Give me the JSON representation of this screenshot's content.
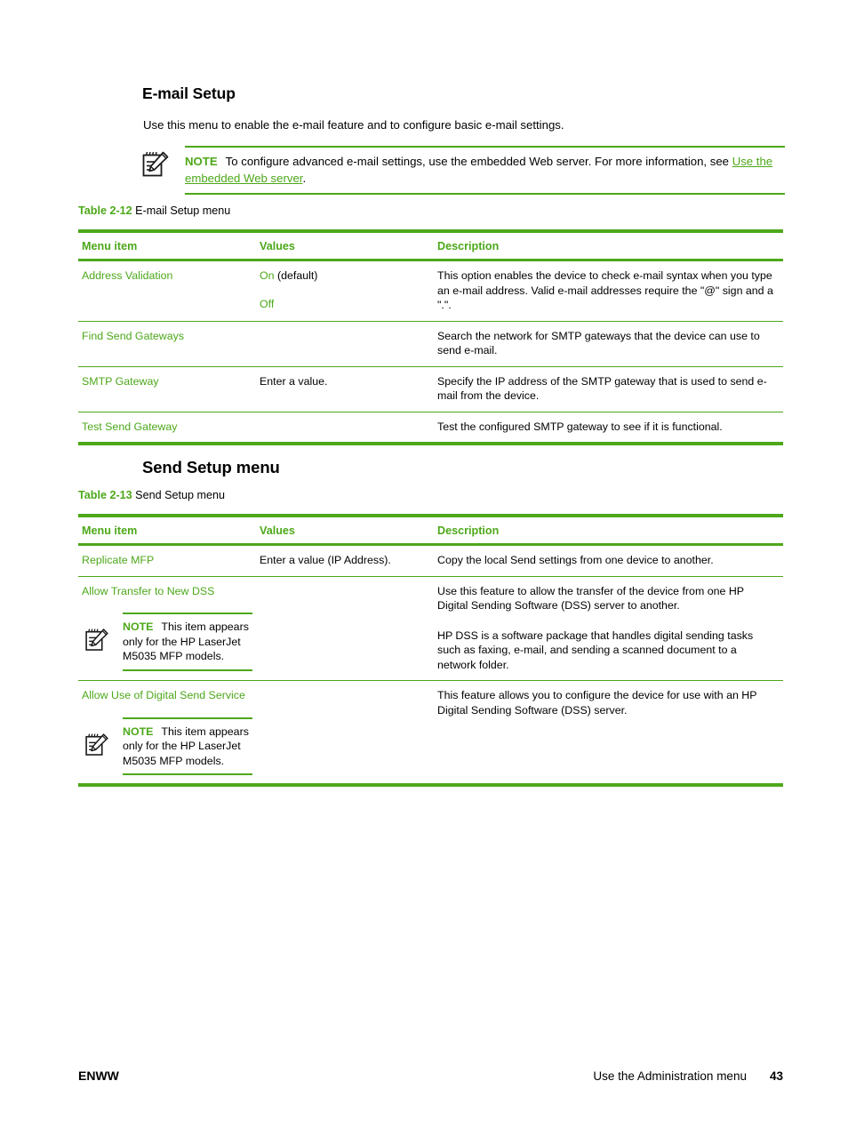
{
  "page": {
    "heading1": "E-mail Setup",
    "intro": "Use this menu to enable the e-mail feature and to configure basic e-mail settings.",
    "heading2": "Send Setup menu",
    "accent_color": "#4da81a"
  },
  "note_top": {
    "icon": "note-pad-pencil-icon",
    "label": "NOTE",
    "text_before_link": "To configure advanced e-mail settings, use the embedded Web server. For more information, see ",
    "link_text": "Use the embedded Web server",
    "text_after_link": "."
  },
  "table_1": {
    "caption_number": "Table 2-12",
    "caption_title": "E-mail Setup menu",
    "headers": [
      "Menu item",
      "Values",
      "Description"
    ],
    "rows": [
      {
        "menu_item": "Address Validation",
        "value_green_1": "On",
        "value_plain_1": " (default)",
        "value_green_2": "Off",
        "description": "This option enables the device to check e-mail syntax when you type an e-mail address. Valid e-mail addresses require the \"@\" sign and a \".\"."
      },
      {
        "menu_item": "Find Send Gateways",
        "values": "",
        "description": "Search the network for SMTP gateways that the device can use to send e-mail."
      },
      {
        "menu_item": "SMTP Gateway",
        "values": "Enter a value.",
        "description": "Specify the IP address of the SMTP gateway that is used to send e-mail from the device."
      },
      {
        "menu_item": "Test Send Gateway",
        "values": "",
        "description": "Test the configured SMTP gateway to see if it is functional."
      }
    ]
  },
  "table_2": {
    "caption_number": "Table 2-13",
    "caption_title": "Send Setup menu",
    "headers": [
      "Menu item",
      "Values",
      "Description"
    ],
    "rows": [
      {
        "menu_item": "Replicate MFP",
        "values": "Enter a value (IP Address).",
        "description": "Copy the local Send settings from one device to another."
      },
      {
        "menu_item": "Allow Transfer to New DSS",
        "note": {
          "icon": "note-pad-pencil-icon",
          "label": "NOTE",
          "text": "This item appears only for the HP LaserJet M5035 MFP models."
        },
        "values": "",
        "description_p1": "Use this feature to allow the transfer of the device from one HP Digital Sending Software (DSS) server to another.",
        "description_p2": "HP DSS is a software package that handles digital sending tasks such as faxing, e-mail, and sending a scanned document to a network folder."
      },
      {
        "menu_item": "Allow Use of Digital Send Service",
        "note": {
          "icon": "note-pad-pencil-icon",
          "label": "NOTE",
          "text": "This item appears only for the HP LaserJet M5035 MFP models."
        },
        "values": "",
        "description_p1": "This feature allows you to configure the device for use with an HP Digital Sending Software (DSS) server."
      }
    ]
  },
  "footer": {
    "left": "ENWW",
    "right_title": "Use the Administration menu",
    "page_number": "43"
  }
}
